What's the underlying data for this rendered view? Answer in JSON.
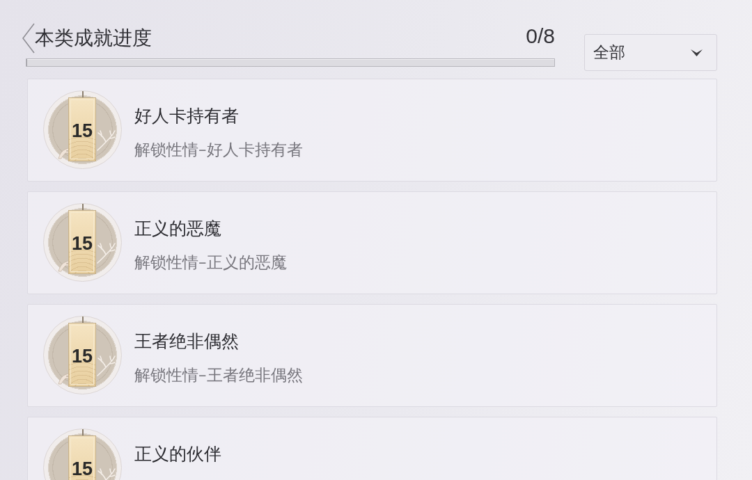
{
  "header": {
    "title": "本类成就进度",
    "count": "0/8",
    "progress": {
      "level": 0
    }
  },
  "filter": {
    "value": "全部"
  },
  "achievements": [
    {
      "badge_number": "15",
      "title": "好人卡持有者",
      "description": "解锁性情–好人卡持有者"
    },
    {
      "badge_number": "15",
      "title": "正义的恶魔",
      "description": "解锁性情–正义的恶魔"
    },
    {
      "badge_number": "15",
      "title": "王者绝非偶然",
      "description": "解锁性情–王者绝非偶然"
    },
    {
      "badge_number": "15",
      "title": "正义的伙伴"
    }
  ]
}
